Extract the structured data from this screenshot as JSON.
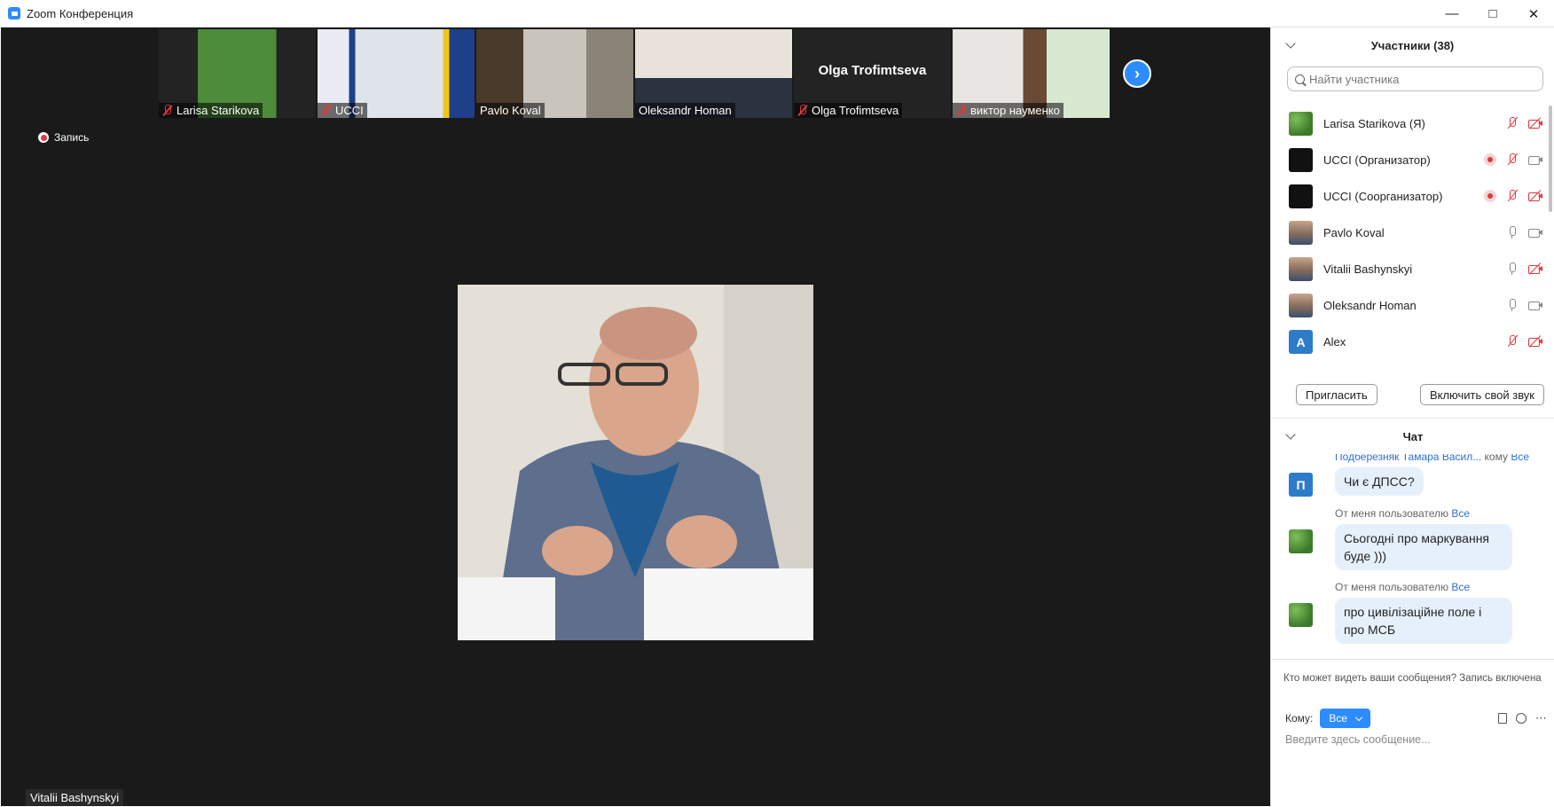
{
  "window": {
    "title": "Zoom Конференция"
  },
  "filmstrip": [
    {
      "name": "Larisa Starikova",
      "muted": true
    },
    {
      "name": "UCCI",
      "muted": true
    },
    {
      "name": "Pavlo Koval",
      "muted": false
    },
    {
      "name": "Oleksandr Homan",
      "muted": false
    },
    {
      "name": "Olga Trofimtseva",
      "muted": true,
      "big_name": "Olga Trofimtseva"
    },
    {
      "name": "виктор науменко",
      "muted": true
    }
  ],
  "recording": {
    "label": "Запись"
  },
  "active_speaker": {
    "name": "Vitalii Bashynskyi"
  },
  "participants": {
    "title": "Участники (38)",
    "search_placeholder": "Найти участника",
    "items": [
      {
        "name": "Larisa Starikova (Я)",
        "mic": "muted",
        "cam": "off",
        "rec": false
      },
      {
        "name": "UCCI (Организатор)",
        "mic": "muted",
        "cam": "on",
        "rec": true
      },
      {
        "name": "UCCI (Соорганизатор)",
        "mic": "muted",
        "cam": "off",
        "rec": true
      },
      {
        "name": "Pavlo Koval",
        "mic": "on",
        "cam": "on",
        "rec": false
      },
      {
        "name": "Vitalii Bashynskyi",
        "mic": "on",
        "cam": "off",
        "rec": false
      },
      {
        "name": "Oleksandr Homan",
        "mic": "on",
        "cam": "on",
        "rec": false
      },
      {
        "name": "Alex",
        "mic": "muted",
        "cam": "off",
        "rec": false,
        "letter": "A"
      }
    ],
    "invite_label": "Пригласить",
    "unmute_label": "Включить свой звук"
  },
  "chat": {
    "title": "Чат",
    "messages": [
      {
        "from": "Подберезняк Тамара Васил...",
        "to_prefix": "кому",
        "to": "Все",
        "letter": "П",
        "text": "Чи є ДПСС?"
      },
      {
        "from_prefix": "От меня пользователю",
        "to": "Все",
        "text": "Сьогодні про маркування буде )))"
      },
      {
        "from_prefix": "От меня пользователю",
        "to": "Все",
        "text": "про цивілізаційне поле і про МСБ"
      }
    ],
    "privacy_note": "Кто может видеть ваши сообщения? Запись включена",
    "to_label": "Кому:",
    "to_value": "Все",
    "input_placeholder": "Введите здесь сообщение..."
  },
  "colors": {
    "accent": "#2d8cff",
    "muted_red": "#e0383e",
    "video_bg": "#1a1a1a"
  }
}
